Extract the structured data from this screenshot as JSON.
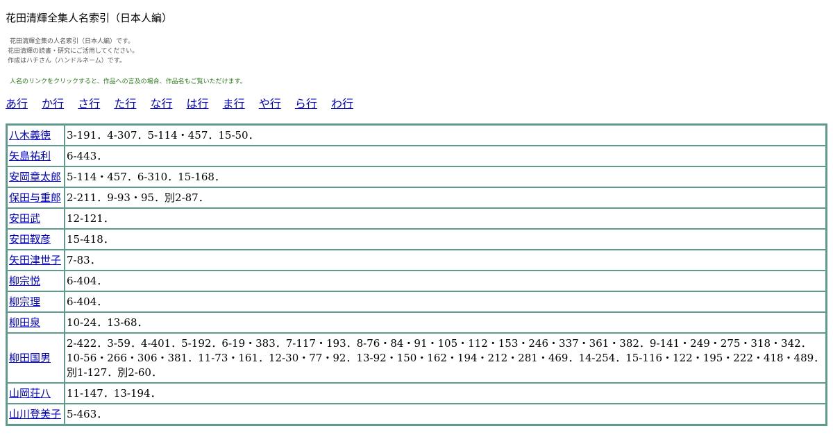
{
  "title": "花田清輝全集人名索引（日本人編）",
  "intro": [
    "花田清輝全集の人名索引（日本人編）です。",
    "花田清輝の読書・研究にご活用してください。",
    "作成はハチさん（ハンドルネーム）です。"
  ],
  "note": "人名のリンクをクリックすると、作品への言及の場合、作品名もご覧いただけます。",
  "nav": [
    "あ行",
    "か行",
    "さ行",
    "た行",
    "な行",
    "は行",
    "ま行",
    "や行",
    "ら行",
    "わ行"
  ],
  "rows": [
    {
      "name": "八木義徳",
      "pages": "3-191．4-307．5-114・457．15-50．"
    },
    {
      "name": "矢島祐利",
      "pages": "6-443．"
    },
    {
      "name": "安岡章太郎",
      "pages": "5-114・457．6-310．15-168．"
    },
    {
      "name": "保田与重郎",
      "pages": "2-211．9-93・95．別2-87．"
    },
    {
      "name": "安田武",
      "pages": "12-121．"
    },
    {
      "name": "安田靫彦",
      "pages": "15-418．"
    },
    {
      "name": "矢田津世子",
      "pages": "7-83．"
    },
    {
      "name": "柳宗悦",
      "pages": "6-404．"
    },
    {
      "name": "柳宗理",
      "pages": "6-404．"
    },
    {
      "name": "柳田泉",
      "pages": "10-24．13-68．"
    },
    {
      "name": "柳田国男",
      "pages": "2-422．3-59．4-401．5-192．6-19・383．7-117・193．8-76・84・91・105・112・153・246・337・361・382．9-141・249・275・318・342．10-56・266・306・381．11-73・161．12-30・77・92．13-92・150・162・194・212・281・469．14-254．15-116・122・195・222・418・489．別1-127．別2-60．"
    },
    {
      "name": "山岡荘八",
      "pages": "11-147．13-194．"
    },
    {
      "name": "山川登美子",
      "pages": "5-463．"
    }
  ]
}
